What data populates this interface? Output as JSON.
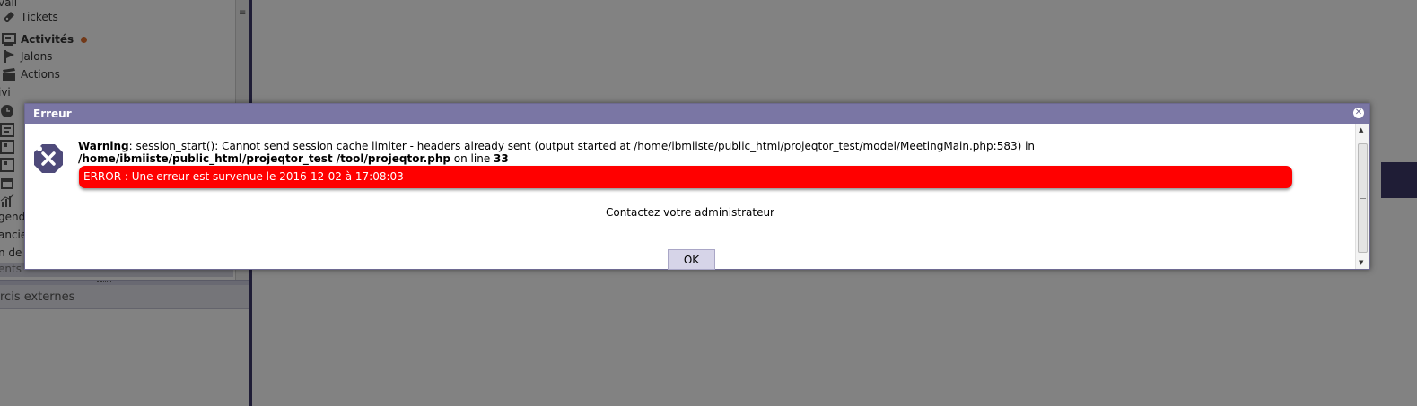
{
  "menu": {
    "partial_top": "vail",
    "tickets": "Tickets",
    "activites": "Activités",
    "jalons": "Jalons",
    "actions": "Actions",
    "group_suivi": "ivi",
    "frag_1": "",
    "frag_2": "",
    "frag_3": "",
    "frag_agenda": "genda",
    "frag_finances": "ancie",
    "frag_plan": "n de",
    "frag_documents": "ents",
    "activity_dot_color": "#e07030"
  },
  "shortcuts": {
    "title": "rcis externes"
  },
  "dialog": {
    "title": "Erreur",
    "close_icon": "close-icon",
    "warning_label": "Warning",
    "warning_message": ": session_start(): Cannot send session cache limiter - headers already sent (output started at /home/ibmiiste/public_html/projeqtor_test/model/MeetingMain.php:583) in ",
    "warning_file": "/home/ibmiiste/public_html/projeqtor_test /tool/projeqtor.php",
    "warning_online": " on line ",
    "warning_line": "33",
    "error_message": "ERROR : Une erreur est survenue le 2016-12-02 à 17:08:03",
    "contact_message": "Contactez votre administrateur",
    "ok_label": "OK",
    "error_color": "#ff0000",
    "titlebar_color": "#7a76a4"
  }
}
